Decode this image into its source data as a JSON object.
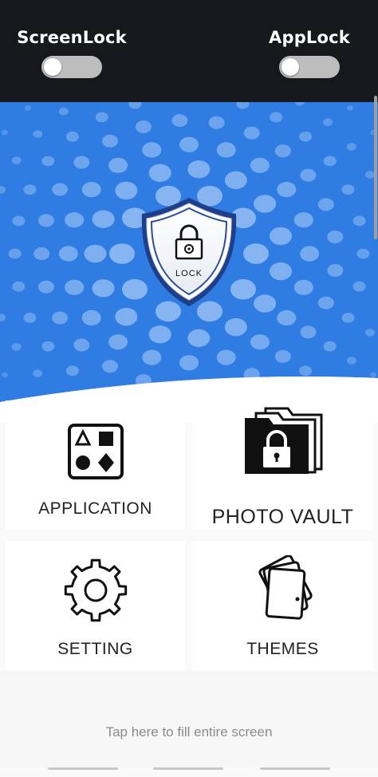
{
  "header": {
    "screen_lock": {
      "label": "ScreenLock",
      "enabled": false
    },
    "app_lock": {
      "label": "AppLock",
      "enabled": false
    }
  },
  "hero": {
    "shield_text": "LOCK",
    "background_color": "#2f7de2"
  },
  "grid": {
    "application": {
      "label": "APPLICATION",
      "icon": "app-grid-icon"
    },
    "photo_vault": {
      "label": "PHOTO VAULT",
      "icon": "locked-folder-icon"
    },
    "setting": {
      "label": "SETTING",
      "icon": "gear-icon"
    },
    "themes": {
      "label": "THEMES",
      "icon": "cards-icon"
    }
  },
  "footer": {
    "fill_screen_text": "Tap here to fill entire screen"
  },
  "colors": {
    "topbar": "#16181b",
    "accent_blue": "#2f7de2",
    "toggle_off": "#bdbdbd"
  }
}
